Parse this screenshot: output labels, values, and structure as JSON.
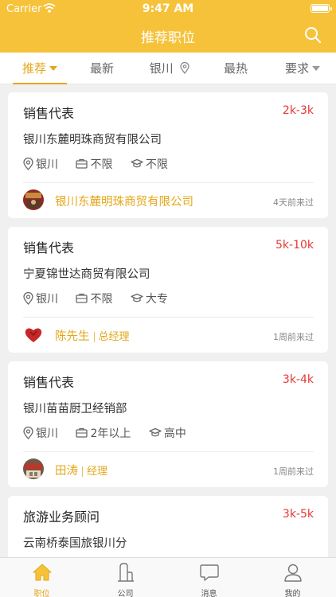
{
  "status": {
    "carrier": "Carrier",
    "time": "9:47 AM"
  },
  "nav": {
    "title": "推荐职位"
  },
  "tabs": {
    "recommend": "推荐",
    "newest": "最新",
    "city": "银川",
    "hottest": "最热",
    "requirements": "要求"
  },
  "jobs": [
    {
      "title": "销售代表",
      "salary": "2k-3k",
      "company": "银川东麓明珠商贸有限公司",
      "location": "银川",
      "experience": "不限",
      "education": "不限",
      "recruiter": "银川东麓明珠商贸有限公司",
      "role": "",
      "visited": "4天前来过"
    },
    {
      "title": "销售代表",
      "salary": "5k-10k",
      "company": "宁夏锦世达商贸有限公司",
      "location": "银川",
      "experience": "不限",
      "education": "大专",
      "recruiter": "陈先生",
      "role": "总经理",
      "visited": "1周前来过"
    },
    {
      "title": "销售代表",
      "salary": "3k-4k",
      "company": "银川苗苗厨卫经销部",
      "location": "银川",
      "experience": "2年以上",
      "education": "高中",
      "recruiter": "田涛",
      "role": "经理",
      "visited": "1周前来过"
    },
    {
      "title": "旅游业务顾问",
      "salary": "3k-5k",
      "company": "云南桥泰国旅银川分",
      "location": "",
      "experience": "",
      "education": "",
      "recruiter": "",
      "role": "",
      "visited": ""
    }
  ],
  "tabbar": {
    "jobs": "职位",
    "company": "公司",
    "messages": "消息",
    "mine": "我的"
  },
  "colors": {
    "brand": "#f6c23a",
    "accent": "#e5a718",
    "salary": "#e53935"
  },
  "icons": {
    "search": "search-icon",
    "location": "location-pin-icon",
    "experience": "briefcase-icon",
    "education": "graduation-cap-icon",
    "tab_jobs": "home-icon",
    "tab_company": "building-icon",
    "tab_messages": "chat-bubble-icon",
    "tab_mine": "person-icon"
  }
}
